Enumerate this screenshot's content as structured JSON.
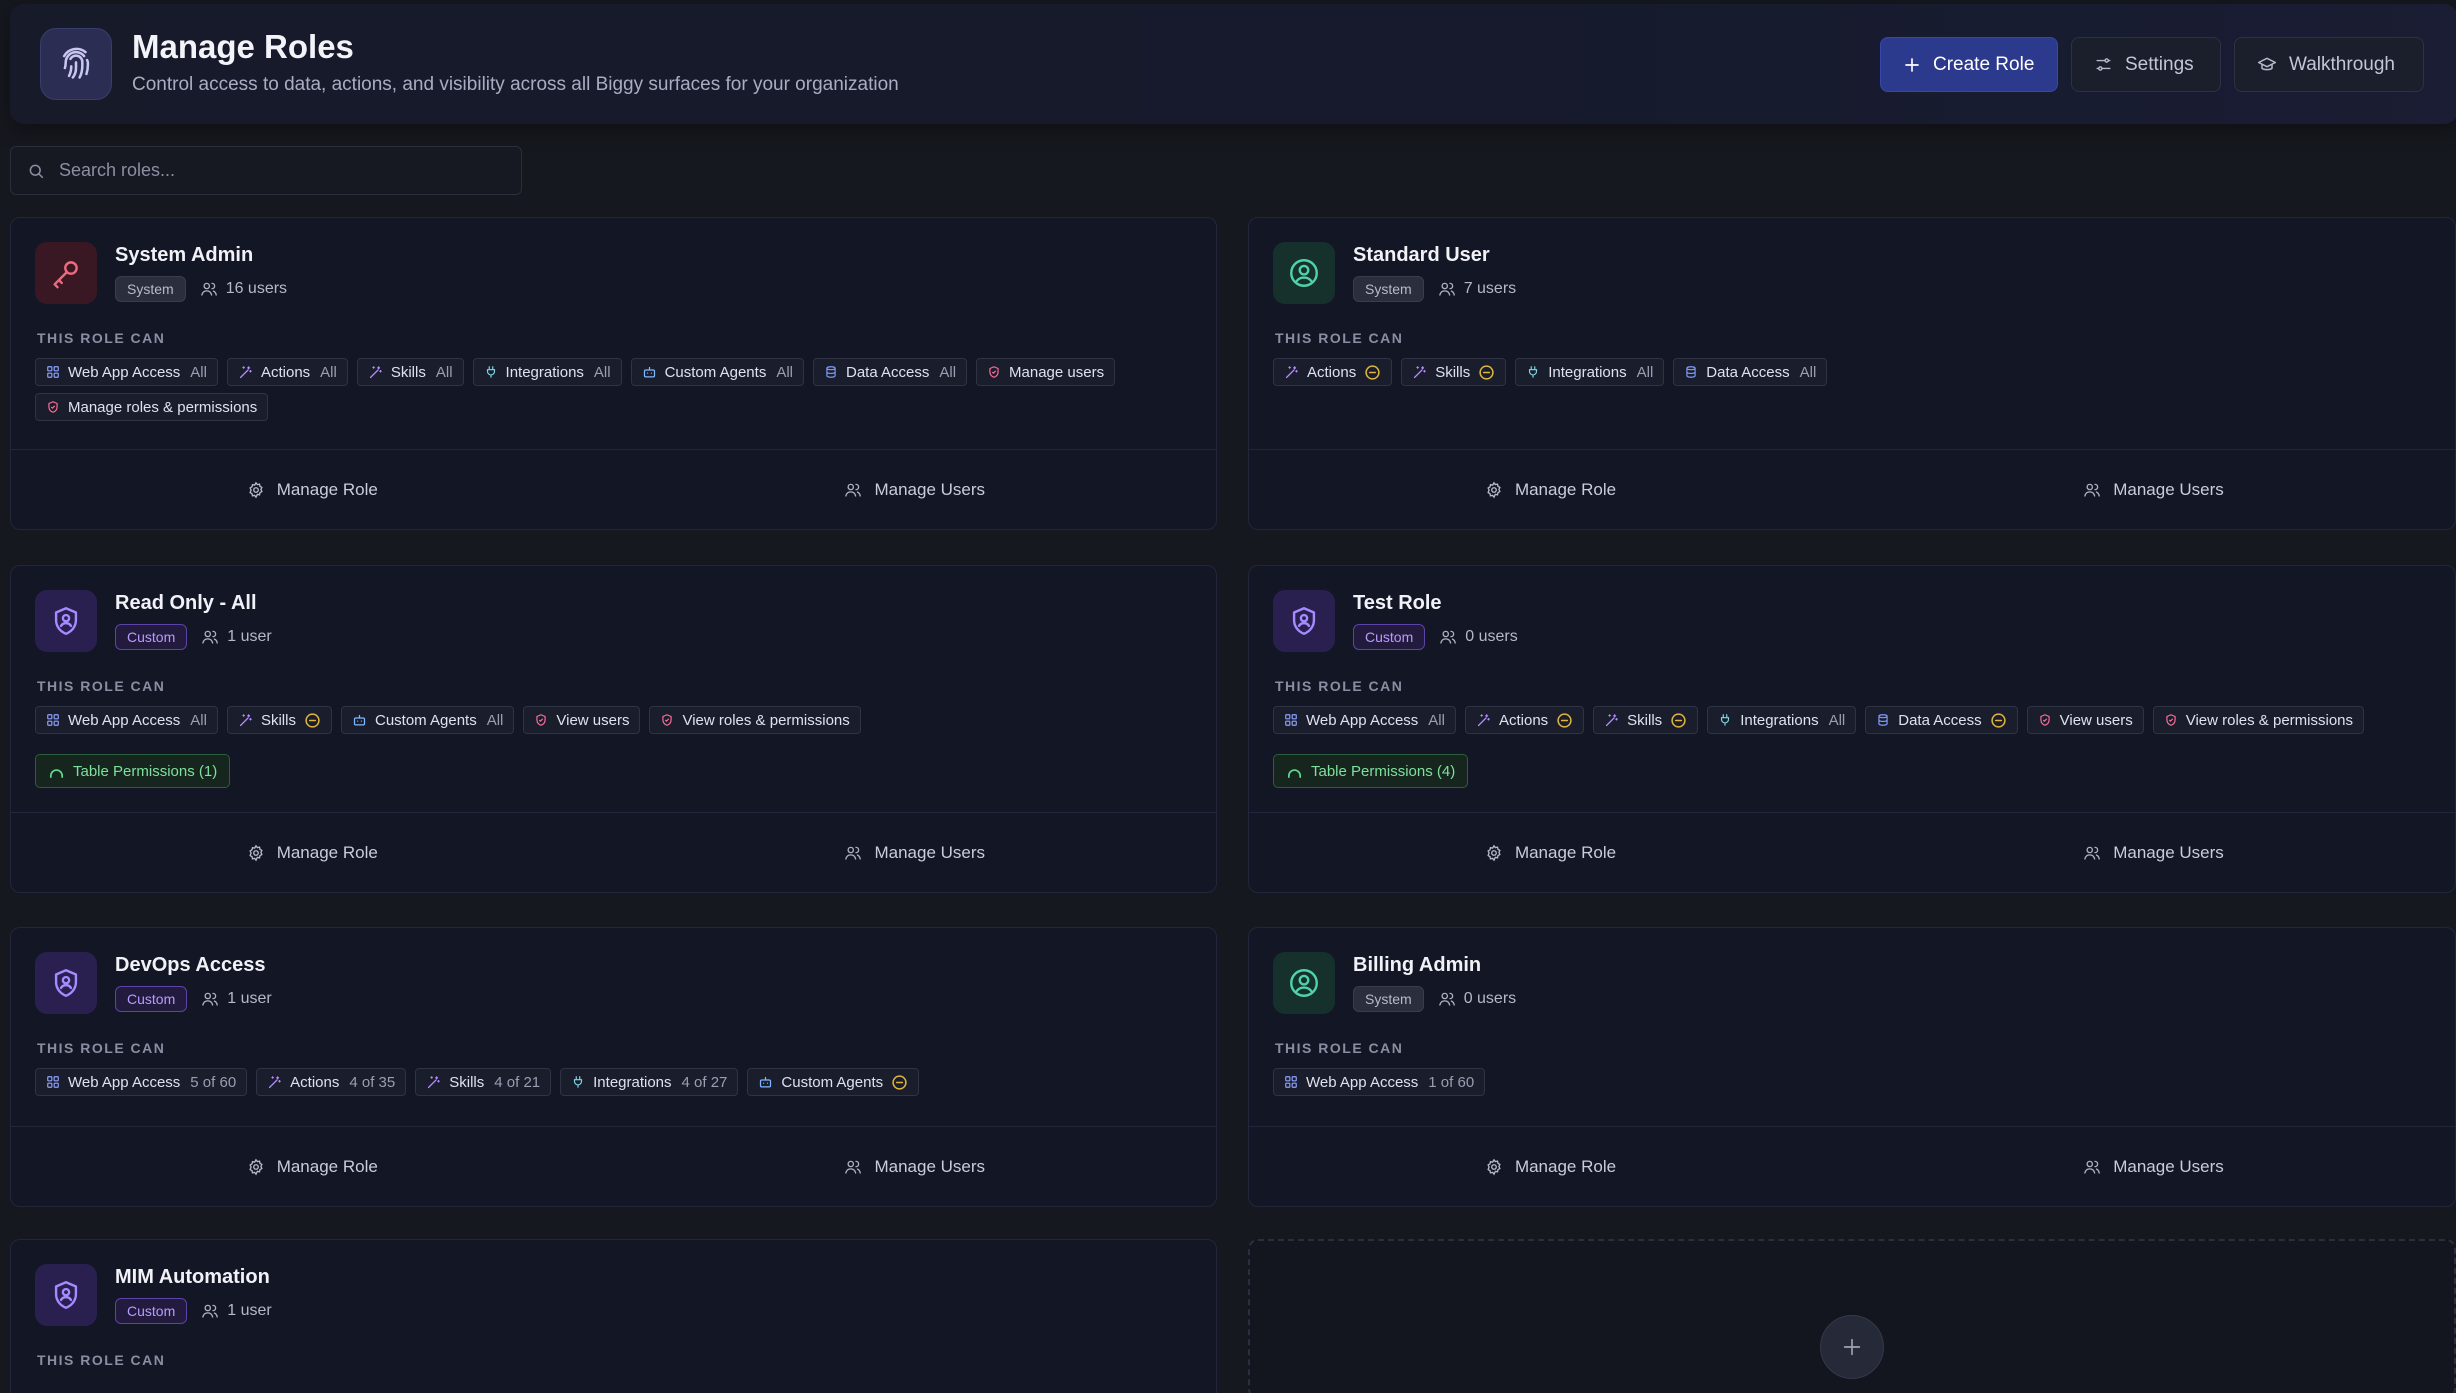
{
  "header": {
    "title": "Manage Roles",
    "subtitle": "Control access to data, actions, and visibility across all Biggy surfaces for your organization",
    "create_label": "Create Role",
    "settings_label": "Settings",
    "walkthrough_label": "Walkthrough"
  },
  "search": {
    "placeholder": "Search roles..."
  },
  "section_label": "THIS ROLE CAN",
  "footer": {
    "manage_role": "Manage Role",
    "manage_users": "Manage Users"
  },
  "roles": [
    {
      "name": "System Admin",
      "badge": "System",
      "users": "16 users",
      "icon": "key-icon",
      "chips": [
        {
          "icon": "grid-icon",
          "label": "Web App Access",
          "level": "All"
        },
        {
          "icon": "wand-icon",
          "label": "Actions",
          "level": "All"
        },
        {
          "icon": "wand-icon",
          "label": "Skills",
          "level": "All"
        },
        {
          "icon": "plug-icon",
          "label": "Integrations",
          "level": "All"
        },
        {
          "icon": "bot-icon",
          "label": "Custom Agents",
          "level": "All"
        },
        {
          "icon": "database-icon",
          "label": "Data Access",
          "level": "All"
        },
        {
          "icon": "shield-icon",
          "label": "Manage users",
          "level": ""
        },
        {
          "icon": "shield-icon",
          "label": "Manage roles & permissions",
          "level": ""
        }
      ],
      "table_permissions": ""
    },
    {
      "name": "Standard User",
      "badge": "System",
      "users": "7 users",
      "icon": "user-circle-icon",
      "chips": [
        {
          "icon": "wand-icon",
          "label": "Actions",
          "level": "partial"
        },
        {
          "icon": "wand-icon",
          "label": "Skills",
          "level": "partial"
        },
        {
          "icon": "plug-icon",
          "label": "Integrations",
          "level": "All"
        },
        {
          "icon": "database-icon",
          "label": "Data Access",
          "level": "All"
        }
      ],
      "table_permissions": ""
    },
    {
      "name": "Read Only - All",
      "badge": "Custom",
      "users": "1 user",
      "icon": "shield-user-icon",
      "chips": [
        {
          "icon": "grid-icon",
          "label": "Web App Access",
          "level": "All"
        },
        {
          "icon": "wand-icon",
          "label": "Skills",
          "level": "partial"
        },
        {
          "icon": "bot-icon",
          "label": "Custom Agents",
          "level": "All"
        },
        {
          "icon": "shield-icon",
          "label": "View users",
          "level": ""
        },
        {
          "icon": "shield-icon",
          "label": "View roles & permissions",
          "level": ""
        }
      ],
      "table_permissions": "Table Permissions (1)"
    },
    {
      "name": "Test Role",
      "badge": "Custom",
      "users": "0 users",
      "icon": "shield-user-icon",
      "chips": [
        {
          "icon": "grid-icon",
          "label": "Web App Access",
          "level": "All"
        },
        {
          "icon": "wand-icon",
          "label": "Actions",
          "level": "partial"
        },
        {
          "icon": "wand-icon",
          "label": "Skills",
          "level": "partial"
        },
        {
          "icon": "plug-icon",
          "label": "Integrations",
          "level": "All"
        },
        {
          "icon": "database-icon",
          "label": "Data Access",
          "level": "partial"
        },
        {
          "icon": "shield-icon",
          "label": "View users",
          "level": ""
        },
        {
          "icon": "shield-icon",
          "label": "View roles & permissions",
          "level": ""
        }
      ],
      "table_permissions": "Table Permissions (4)"
    },
    {
      "name": "DevOps Access",
      "badge": "Custom",
      "users": "1 user",
      "icon": "shield-user-icon",
      "chips": [
        {
          "icon": "grid-icon",
          "label": "Web App Access",
          "level": "5 of 60"
        },
        {
          "icon": "wand-icon",
          "label": "Actions",
          "level": "4 of 35"
        },
        {
          "icon": "wand-icon",
          "label": "Skills",
          "level": "4 of 21"
        },
        {
          "icon": "plug-icon",
          "label": "Integrations",
          "level": "4 of 27"
        },
        {
          "icon": "bot-icon",
          "label": "Custom Agents",
          "level": "partial"
        }
      ],
      "table_permissions": ""
    },
    {
      "name": "Billing Admin",
      "badge": "System",
      "users": "0 users",
      "icon": "user-circle-icon",
      "chips": [
        {
          "icon": "grid-icon",
          "label": "Web App Access",
          "level": "1 of 60"
        }
      ],
      "table_permissions": ""
    },
    {
      "name": "MIM Automation",
      "badge": "Custom",
      "users": "1 user",
      "icon": "shield-user-icon",
      "chips": [],
      "table_permissions": ""
    }
  ],
  "colors": {
    "accent": "#2c3a8e",
    "custom_badge": "#b79cff",
    "system_badge": "#b7bacb",
    "partial": "#e0b53c",
    "table_perm": "#7ee09c"
  }
}
